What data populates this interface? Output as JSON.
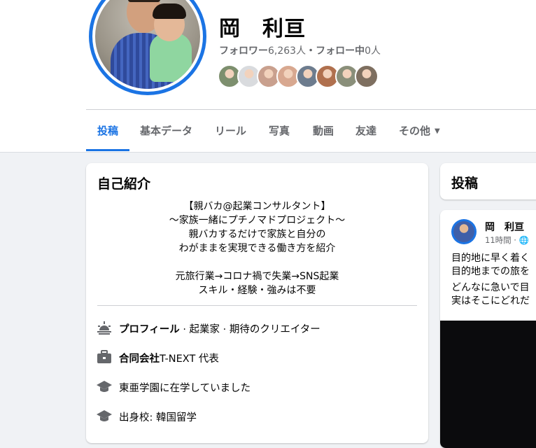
{
  "profile": {
    "name": "岡　利亘",
    "followers_label": "フォロワー",
    "followers_count": "6,263人",
    "following_label": "・フォロー中",
    "following_count": "0人"
  },
  "friend_avatar_colors": [
    "#7d8f6e",
    "#d9dbde",
    "#c9a08e",
    "#d8a890",
    "#6d7c8e",
    "#b0704e",
    "#8a8f7a",
    "#7e6f60"
  ],
  "tabs": [
    {
      "label": "投稿",
      "active": true
    },
    {
      "label": "基本データ"
    },
    {
      "label": "リール"
    },
    {
      "label": "写真"
    },
    {
      "label": "動画"
    },
    {
      "label": "友達"
    },
    {
      "label": "その他"
    }
  ],
  "intro": {
    "title": "自己紹介",
    "bio": [
      "【親バカ@起業コンサルタント】",
      "～家族一緒にプチノマドプロジェクト～",
      "親バカするだけで家族と自分の",
      "わがままを実現できる働き方を紹介",
      "",
      "元旅行業→コロナ禍で失業→SNS起業",
      "スキル・経験・強みは不要"
    ],
    "details": [
      {
        "icon": "profile-icon",
        "bold": "プロフィール",
        "text": " · 起業家 · 期待のクリエイター"
      },
      {
        "icon": "briefcase-icon",
        "bold": "合同会社",
        "text": "T-NEXT 代表"
      },
      {
        "icon": "graduation-cap-icon",
        "bold": "",
        "text": "東亜学園に在学していました"
      },
      {
        "icon": "graduation-cap-icon",
        "bold": "",
        "text": "出身校: 韓国留学"
      }
    ]
  },
  "posts": {
    "title": "投稿",
    "author": "岡　利亘",
    "time": "11時間 ·",
    "lines": [
      "目的地に早く着く",
      "目的地までの旅を",
      "どんなに急いで目",
      "実はそこにどれだ"
    ]
  },
  "colors": {
    "accent": "#1b74e4",
    "muted": "#65676b",
    "background": "#f0f2f5"
  }
}
